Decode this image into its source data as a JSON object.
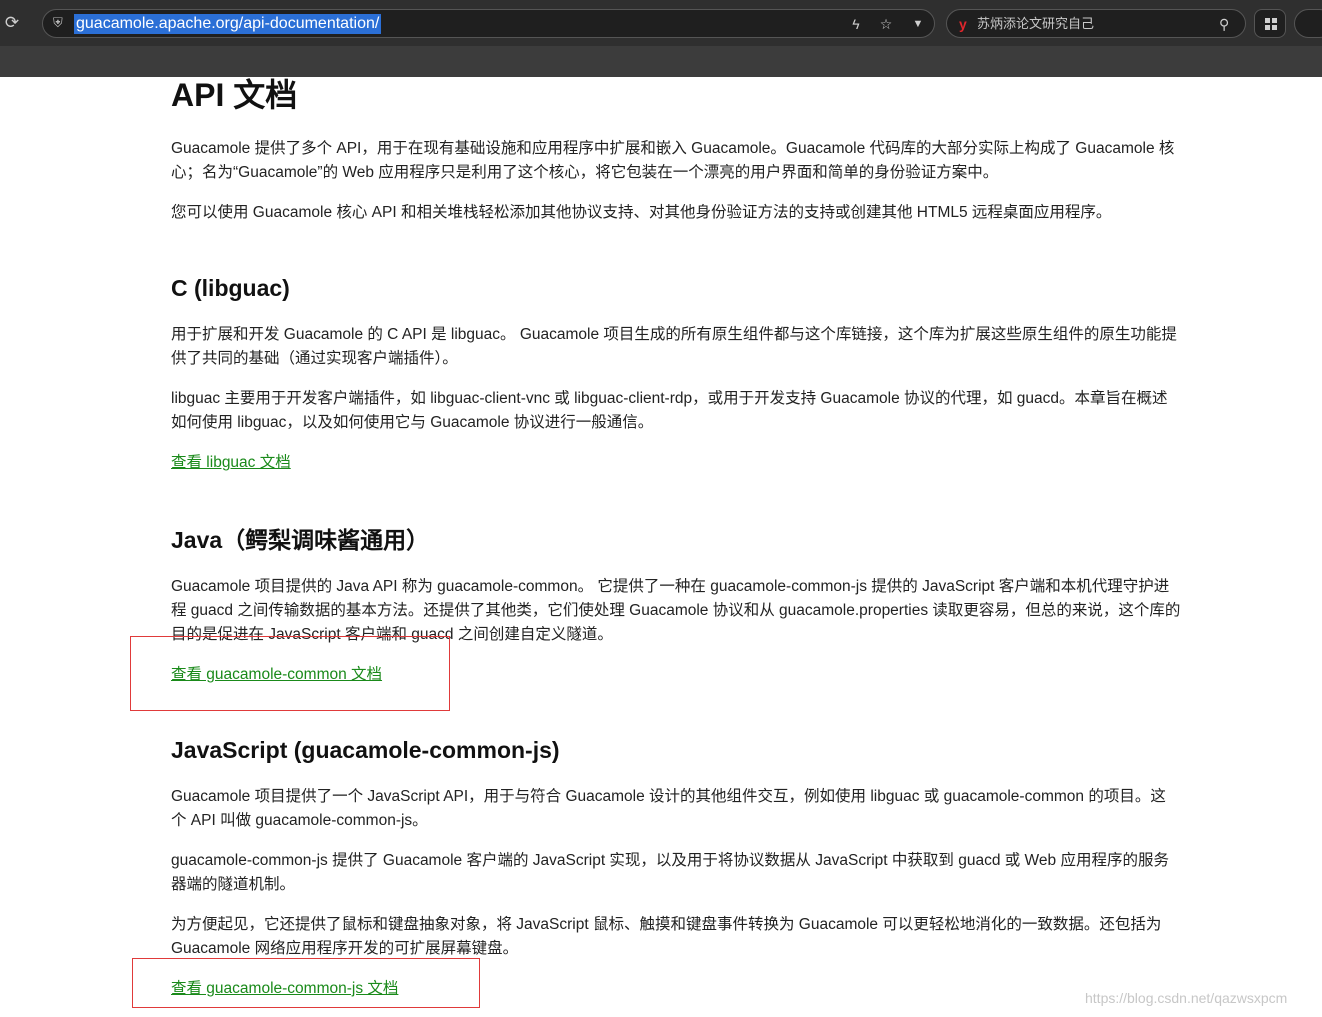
{
  "browser": {
    "url": "guacamole.apache.org/api-documentation/",
    "search_brand": "y",
    "search_text": "苏炳添论文研究自己"
  },
  "page": {
    "title": "API 文档",
    "intro": [
      "Guacamole 提供了多个 API，用于在现有基础设施和应用程序中扩展和嵌入 Guacamole。Guacamole 代码库的大部分实际上构成了 Guacamole 核心；名为“Guacamole”的 Web 应用程序只是利用了这个核心，将它包装在一个漂亮的用户界面和简单的身份验证方案中。",
      "您可以使用 Guacamole 核心 API 和相关堆栈轻松添加其他协议支持、对其他身份验证方法的支持或创建其他 HTML5 远程桌面应用程序。"
    ],
    "sections": [
      {
        "heading": "C (libguac)",
        "paragraphs": [
          "用于扩展和开发 Guacamole 的 C API 是 libguac。 Guacamole 项目生成的所有原生组件都与这个库链接，这个库为扩展这些原生组件的原生功能提供了共同的基础（通过实现客户端插件）。",
          "libguac 主要用于开发客户端插件，如 libguac-client-vnc 或 libguac-client-rdp，或用于开发支持 Guacamole 协议的代理，如 guacd。本章旨在概述如何使用 libguac，以及如何使用它与 Guacamole 协议进行一般通信。"
        ],
        "link": "查看 libguac 文档"
      },
      {
        "heading": "Java（鳄梨调味酱通用）",
        "paragraphs": [
          "Guacamole 项目提供的 Java API 称为 guacamole-common。 它提供了一种在 guacamole-common-js 提供的 JavaScript 客户端和本机代理守护进程 guacd 之间传输数据的基本方法。还提供了其他类，它们使处理 Guacamole 协议和从 guacamole.properties 读取更容易，但总的来说，这个库的目的是促进在 JavaScript 客户端和 guacd 之间创建自定义隧道。"
        ],
        "link": "查看 guacamole-common 文档"
      },
      {
        "heading": "JavaScript (guacamole-common-js)",
        "paragraphs": [
          "Guacamole 项目提供了一个 JavaScript API，用于与符合 Guacamole 设计的其他组件交互，例如使用 libguac 或 guacamole-common 的项目。这个 API 叫做 guacamole-common-js。",
          "guacamole-common-js 提供了 Guacamole 客户端的 JavaScript 实现，以及用于将协议数据从 JavaScript 中获取到 guacd 或 Web 应用程序的服务器端的隧道机制。",
          "为方便起见，它还提供了鼠标和键盘抽象对象，将 JavaScript 鼠标、触摸和键盘事件转换为 Guacamole 可以更轻松地消化的一致数据。还包括为 Guacamole 网络应用程序开发的可扩展屏幕键盘。"
        ],
        "link": "查看 guacamole-common-js 文档"
      }
    ]
  },
  "watermark": "https://blog.csdn.net/qazwsxpcm"
}
